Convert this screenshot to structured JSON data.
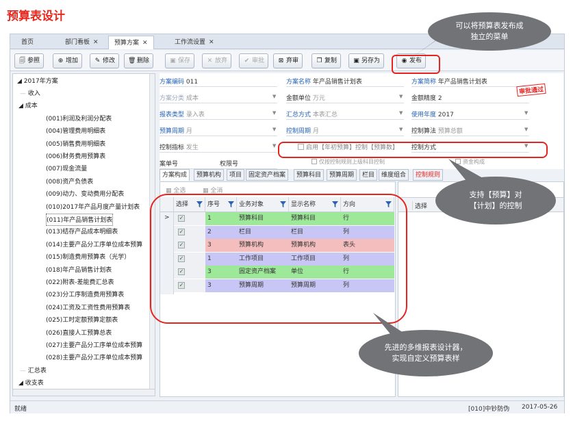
{
  "page_title": "预算表设计",
  "tabs": [
    {
      "label": "首页",
      "closable": false
    },
    {
      "label": "部门看板",
      "closable": true
    },
    {
      "label": "预算方案",
      "closable": true
    },
    {
      "label": "工作流设置",
      "closable": true
    }
  ],
  "close_glyph": "✕",
  "toolbar": {
    "ref": "参照",
    "add": "增加",
    "edit": "修改",
    "delete": "删除",
    "save": "保存",
    "discard": "放弃",
    "approve": "审批",
    "unapprove": "弃审",
    "copy": "复制",
    "save_as": "另存为",
    "publish": "发布"
  },
  "tree": {
    "root": "2017年方案",
    "items": [
      {
        "label": "收入",
        "level": 1
      },
      {
        "label": "成本",
        "level": 1
      },
      {
        "label": "(001)利润及利润分配表",
        "level": 2
      },
      {
        "label": "(004)管理费用明细表",
        "level": 2
      },
      {
        "label": "(005)销售费用明细表",
        "level": 2
      },
      {
        "label": "(006)财务费用预算表",
        "level": 2
      },
      {
        "label": "(007)现金流量",
        "level": 2
      },
      {
        "label": "(008)资产负债表",
        "level": 2
      },
      {
        "label": "(009)动力、变动费用分配表",
        "level": 2
      },
      {
        "label": "(010)2017年产品月度产量计划表",
        "level": 2
      },
      {
        "label": "(011)年产品销售计划表",
        "level": 2,
        "selected": true
      },
      {
        "label": "(013)结存产品成本明细表",
        "level": 2
      },
      {
        "label": "(014)主要产品分工序单位成本预算",
        "level": 2
      },
      {
        "label": "(015)制造费用预算表（光学）",
        "level": 2
      },
      {
        "label": "(018)年产品销售计划表",
        "level": 2
      },
      {
        "label": "(022)附表-差能费汇总表",
        "level": 2
      },
      {
        "label": "(023)分工序制造费用预算表",
        "level": 2
      },
      {
        "label": "(024)工资及工资性费用预算表",
        "level": 2
      },
      {
        "label": "(025)工时定额预算定额表",
        "level": 2
      },
      {
        "label": "(026)直接人工预算总表",
        "level": 2
      },
      {
        "label": "(027)主要产品分工序单位成本预算",
        "level": 2
      },
      {
        "label": "(028)主要产品分工序单位成本预算",
        "level": 2
      },
      {
        "label": "汇总表",
        "level": 1
      },
      {
        "label": "收支表",
        "level": 1
      }
    ]
  },
  "form": {
    "code_label": "方案编码",
    "code_value": "011",
    "name_label": "方案名称",
    "name_value": "年产品销售计划表",
    "short_label": "方案简称",
    "short_value": "年产品销售计划表",
    "category_label": "方案分类",
    "category_value": "成本",
    "unit_label": "金额单位",
    "unit_value": "万元",
    "precision_label": "金额精度",
    "precision_value": "2",
    "report_type_label": "报表类型",
    "report_type_value": "录入表",
    "summary_label": "汇总方式",
    "summary_value": "本表汇总",
    "year_label": "使用年度",
    "year_value": "2017",
    "period_label": "预算周期",
    "period_value": "月",
    "control_period_label": "控制周期",
    "control_period_value": "月",
    "control_algo_label": "控制算法",
    "control_algo_value": "预算总额",
    "control_index_label": "控制指标",
    "control_index_value": "发生",
    "enable_check_label": "启用【年初预算】控制【预算数】",
    "control_method_label": "控制方式",
    "only_upper_label": "仅按控制规则上级科目控制",
    "fund_label": "资金构成",
    "ticket_label": "案单号",
    "limit_label": "权限号",
    "stamp": "审批通过"
  },
  "subtabs": [
    "方案构成",
    "预算机构",
    "项目",
    "固定资产档案",
    "预算科目",
    "预算周期",
    "栏目",
    "维度组合",
    "控制规则"
  ],
  "grid": {
    "select_all": "全选",
    "deselect_all": "全消",
    "columns": [
      "选择",
      "序号",
      "业务对象",
      "显示名称",
      "方向"
    ],
    "rows": [
      {
        "seq": "1",
        "object": "预算科目",
        "display": "预算科目",
        "direction": "行",
        "color": "#9ee89a"
      },
      {
        "seq": "2",
        "object": "栏目",
        "display": "栏目",
        "direction": "列",
        "color": "#c7c6f4"
      },
      {
        "seq": "3",
        "object": "预算机构",
        "display": "预算机构",
        "direction": "表头",
        "color": "#f4bebe"
      },
      {
        "seq": "1",
        "object": "工作项目",
        "display": "工作项目",
        "direction": "列",
        "color": "#c7c6f4"
      },
      {
        "seq": "3",
        "object": "固定资产档案",
        "display": "单位",
        "direction": "行",
        "color": "#9ee89a"
      },
      {
        "seq": "3",
        "object": "预算周期",
        "display": "预算周期",
        "direction": "列",
        "color": "#c7c6f4"
      }
    ],
    "row_pointer": ">",
    "check_glyph": "✓"
  },
  "right_panel": {
    "select_col": "选择"
  },
  "status": {
    "left": "就绪",
    "user": "[010]中钞防伪",
    "date": "2017-05-26"
  },
  "callouts": {
    "publish": "可以将预算表发布成独立的菜单",
    "control": "支持【预算】对【计划】的控制",
    "designer": "先进的多维报表设计器，实现自定义预算表样"
  }
}
